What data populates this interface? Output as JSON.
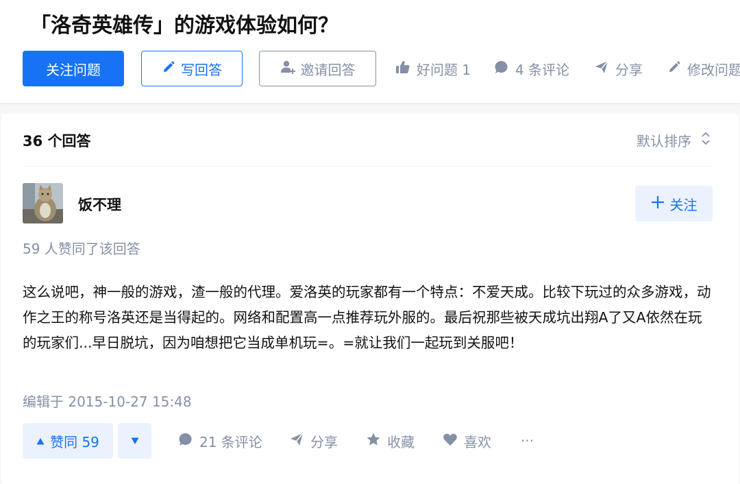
{
  "question": {
    "title": "「洛奇英雄传」的游戏体验如何？",
    "follow_label": "关注问题",
    "write_label": "写回答",
    "invite_label": "邀请回答",
    "good_question_label": "好问题 1",
    "comments_label": "4 条评论",
    "share_label": "分享",
    "edit_label": "修改问题"
  },
  "answers_header": {
    "count_label": "36 个回答",
    "sort_label": "默认排序"
  },
  "answer": {
    "author_name": "饭不理",
    "follow_label": "关注",
    "voters_label": "59 人赞同了该回答",
    "content": "这么说吧，神一般的游戏，渣一般的代理。爱洛英的玩家都有一个特点：不爱天成。比较下玩过的众多游戏，动作之王的称号洛英还是当得起的。网络和配置高一点推荐玩外服的。最后祝那些被天成坑出翔A了又A依然在玩的玩家们...早日脱坑，因为咱想把它当成单机玩=。=就让我们一起玩到关服吧！",
    "edit_time": "编辑于 2015-10-27 15:48",
    "vote_up_label": "赞同 59",
    "comments_label": "21 条评论",
    "share_label": "分享",
    "collect_label": "收藏",
    "like_label": "喜欢",
    "more_label": "···"
  },
  "colors": {
    "brand": "#1772f6",
    "brand_light": "#ebf2fe",
    "muted": "#8590a6",
    "text": "#121212",
    "page_bg": "#f6f6f6"
  },
  "icons": [
    "pencil-icon",
    "invite-user-icon",
    "thumbs-up-icon",
    "comment-icon",
    "share-icon",
    "edit-icon",
    "sort-chevrons-icon",
    "plus-icon",
    "triangle-up-icon",
    "triangle-down-icon",
    "star-icon",
    "heart-icon",
    "more-icon"
  ]
}
